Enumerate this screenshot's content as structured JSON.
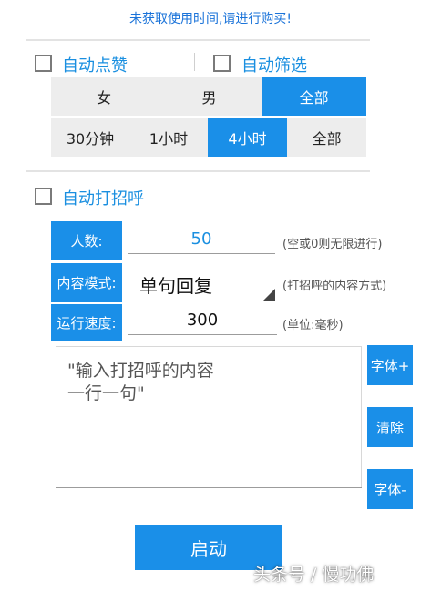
{
  "notice": "未获取使用时间,请进行购买!",
  "auto_like": {
    "label": "自动点赞",
    "checked": false
  },
  "auto_filter": {
    "label": "自动筛选",
    "checked": false
  },
  "gender_options": [
    "女",
    "男",
    "全部"
  ],
  "gender_selected": "全部",
  "time_options": [
    "30分钟",
    "1小时",
    "4小时",
    "全部"
  ],
  "time_selected": "4小时",
  "auto_greet": {
    "label": "自动打招呼",
    "checked": false
  },
  "count": {
    "label": "人数:",
    "value": "50",
    "hint": "(空或0则无限进行)"
  },
  "content_mode": {
    "label": "内容模式:",
    "value": "单句回复",
    "hint": "(打招呼的内容方式)"
  },
  "speed": {
    "label": "运行速度:",
    "value": "300",
    "hint": "(单位:毫秒)"
  },
  "greeting_textarea": {
    "placeholder": "\"输入打招呼的内容\n一行一句\""
  },
  "buttons": {
    "font_up": "字体+",
    "clear": "清除",
    "font_down": "字体-",
    "start": "启动"
  },
  "watermark": "头条号 / 慢功佛",
  "colors": {
    "accent": "#1a8fe8",
    "notice": "#1a73d9",
    "checkbox_label": "#1a8fe0",
    "segment_bg": "#ededed"
  }
}
